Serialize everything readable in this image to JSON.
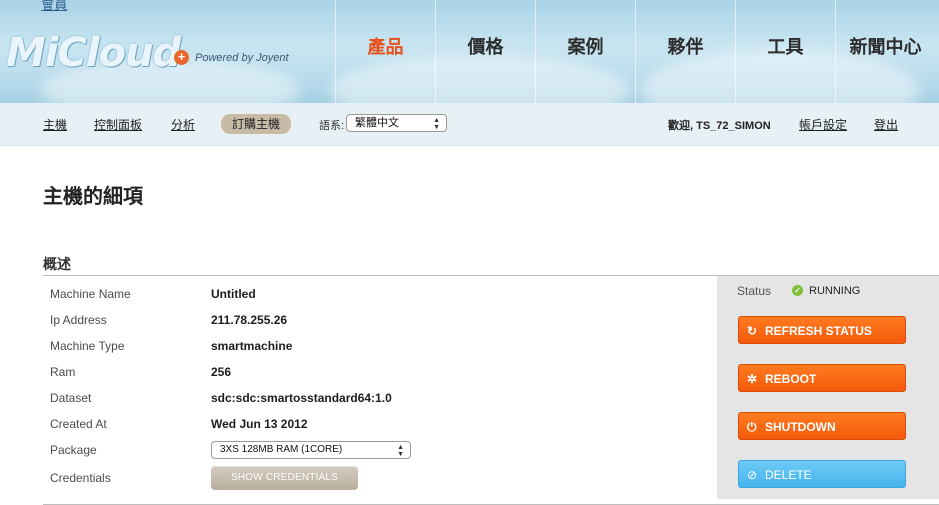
{
  "header": {
    "logo_text": "MiCloud",
    "logo_plus": "+",
    "powered_by": "Powered by Joyent",
    "top_link": "會員",
    "nav": [
      {
        "label": "產品",
        "active": true
      },
      {
        "label": "價格",
        "active": false
      },
      {
        "label": "案例",
        "active": false
      },
      {
        "label": "夥伴",
        "active": false
      },
      {
        "label": "工具",
        "active": false
      },
      {
        "label": "新聞中心",
        "active": false
      }
    ]
  },
  "subnav": {
    "links": [
      "主機",
      "控制面板",
      "分析"
    ],
    "active_pill": "訂購主機",
    "language_label": "語系:",
    "language_value": "繁體中文",
    "welcome": "歡迎, TS_72_SIMON",
    "account_settings": "帳戶設定",
    "logout": "登出"
  },
  "page": {
    "title": "主機的細項",
    "section_title": "概述"
  },
  "details": [
    {
      "label": "Machine Name",
      "value": "Untitled"
    },
    {
      "label": "Ip Address",
      "value": "211.78.255.26"
    },
    {
      "label": "Machine Type",
      "value": "smartmachine"
    },
    {
      "label": "Ram",
      "value": "256"
    },
    {
      "label": "Dataset",
      "value": "sdc:sdc:smartosstandard64:1.0"
    },
    {
      "label": "Created At",
      "value": "Wed Jun 13 2012"
    },
    {
      "label": "Package",
      "value": "3XS 128MB RAM (1CORE)"
    },
    {
      "label": "Credentials",
      "value": "SHOW CREDENTIALS"
    }
  ],
  "status": {
    "label": "Status",
    "value": "RUNNING",
    "color": "#7fbf3a"
  },
  "actions": {
    "refresh": "REFRESH STATUS",
    "reboot": "REBOOT",
    "shutdown": "SHUTDOWN",
    "delete": "DELETE"
  },
  "icons": {
    "check": "check-icon",
    "refresh": "refresh-icon",
    "reboot": "gear-icon",
    "shutdown": "power-icon",
    "delete": "block-icon"
  },
  "colors": {
    "accent_orange": "#f45a0c",
    "delete_blue": "#47b5ec",
    "active_nav": "#e8501c"
  }
}
